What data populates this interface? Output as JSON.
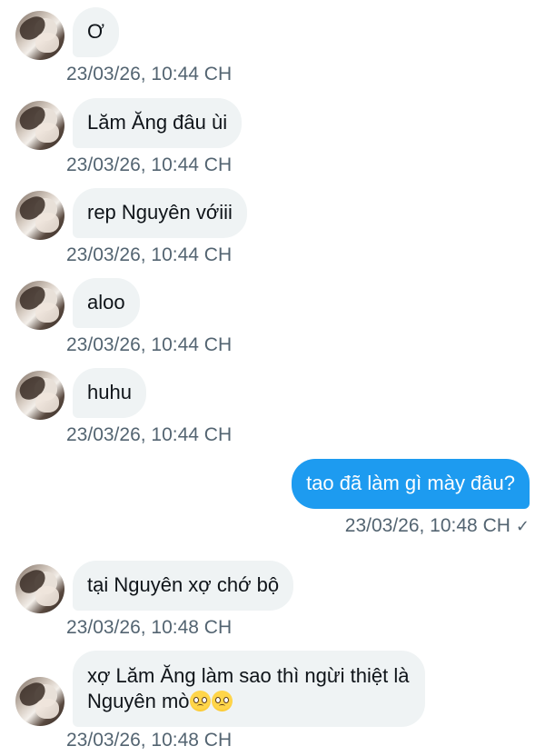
{
  "messages": [
    {
      "dir": "in",
      "text": "Ơ",
      "time": "23/03/26, 10:44 CH"
    },
    {
      "dir": "in",
      "text": "Lăm Ăng đâu ùi",
      "time": "23/03/26, 10:44 CH"
    },
    {
      "dir": "in",
      "text": "rep Nguyên vớiii",
      "time": "23/03/26, 10:44 CH"
    },
    {
      "dir": "in",
      "text": "aloo",
      "time": "23/03/26, 10:44 CH"
    },
    {
      "dir": "in",
      "text": "huhu",
      "time": "23/03/26, 10:44 CH"
    },
    {
      "dir": "out",
      "text": "tao đã làm gì mày đâu?",
      "time": "23/03/26, 10:48 CH",
      "status_icon": "checkmark-icon",
      "status_glyph": "✓"
    },
    {
      "dir": "in",
      "text": "tại Nguyên xợ chớ bộ",
      "time": "23/03/26, 10:48 CH"
    },
    {
      "dir": "in",
      "text": "xợ Lăm Ăng làm sao thì ngừi thiệt là Nguyên mò",
      "emojis": [
        "pleading-face-emoji",
        "pleading-face-emoji"
      ],
      "time": "23/03/26, 10:48 CH"
    }
  ],
  "colors": {
    "incoming_bubble": "#eff3f4",
    "outgoing_bubble": "#1d9bf0",
    "timestamp": "#536471"
  }
}
